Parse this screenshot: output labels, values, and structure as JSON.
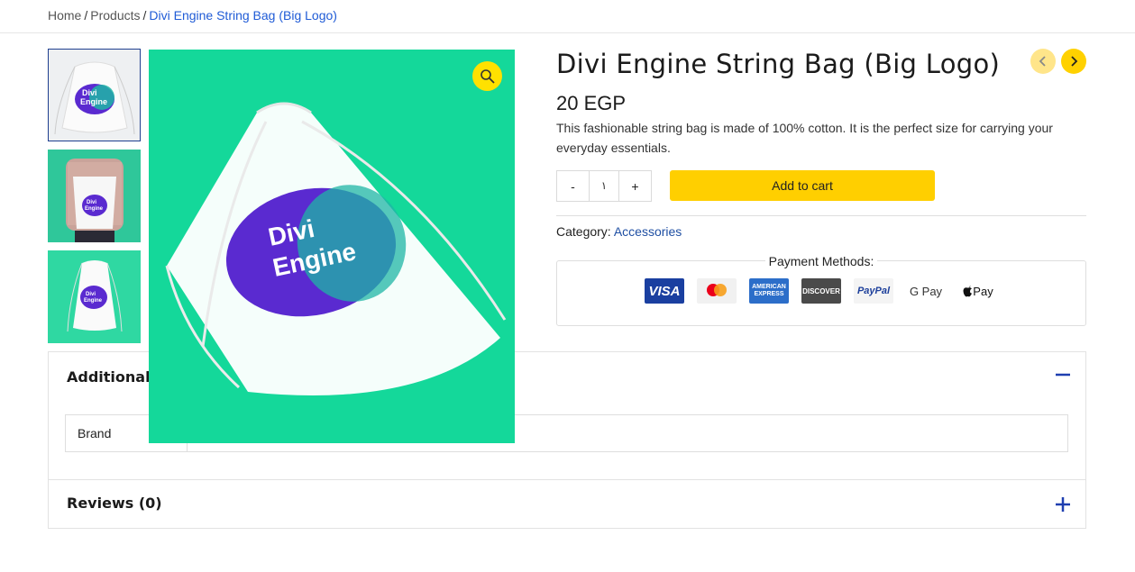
{
  "breadcrumb": {
    "home": "Home",
    "products": "Products",
    "current": "Divi Engine String Bag (Big Logo)",
    "separator": "/"
  },
  "product": {
    "title": "Divi Engine String Bag (Big Logo)",
    "price": "20 EGP",
    "description": "This fashionable string bag is made of 100% cotton. It is the perfect size for carrying your everyday essentials.",
    "quantity": "١",
    "qty_minus": "-",
    "qty_plus": "+",
    "add_to_cart": "Add to cart",
    "category_label": "Category:",
    "category_value": "Accessories",
    "image_text_line1": "Divi",
    "image_text_line2": "Engine"
  },
  "payment": {
    "label": "Payment Methods:",
    "methods": [
      "VISA",
      "mastercard",
      "AMERICAN EXPRESS",
      "DISCOVER",
      "PayPal",
      "G Pay",
      "Pay"
    ]
  },
  "accordion": {
    "additional_info_title": "Additional information",
    "brand_label": "Brand",
    "reviews_title": "Reviews (0)"
  },
  "colors": {
    "accent_yellow": "#ffcf00",
    "link_blue": "#1f5bd6",
    "image_green": "#14d89a",
    "bag_purple": "#5a2ad0"
  }
}
